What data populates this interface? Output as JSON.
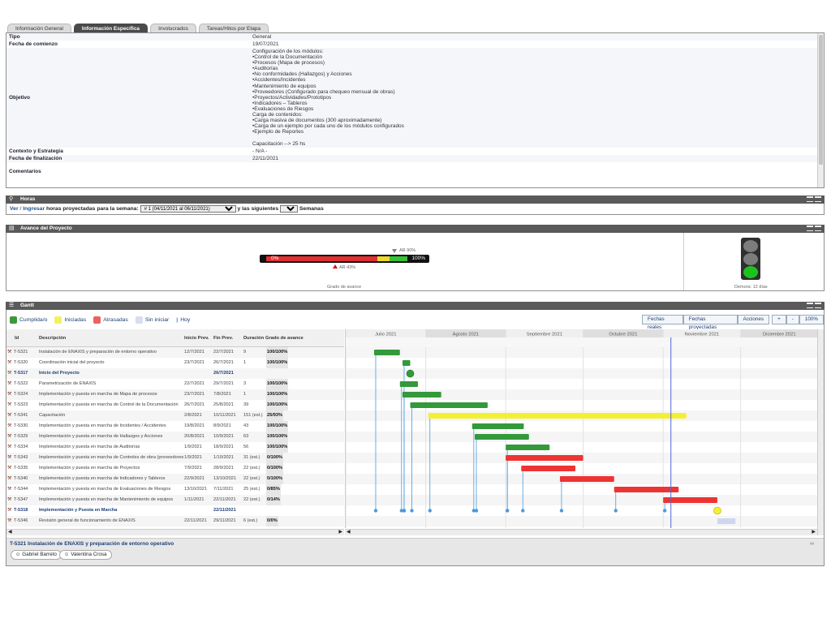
{
  "tabs": [
    {
      "label": "Información General",
      "active": false
    },
    {
      "label": "Información Específica",
      "active": true
    },
    {
      "label": "Involucrados",
      "active": false
    },
    {
      "label": "Tareas/Hitos por Etapa",
      "active": false
    }
  ],
  "info": {
    "tipo_label": "Tipo",
    "tipo_value": "General",
    "fecha_comienzo_label": "Fecha de comienzo",
    "fecha_comienzo_value": "19/07/2021",
    "objetivo_label": "Objetivo",
    "objetivo_lines": [
      "Configuración de los módulos:",
      "•Control de la Documentación",
      "•Procesos (Mapa de procesos)",
      "•Auditorías",
      "•No conformidades (Hallazgos) y Acciones",
      "•Accidentes/Incidentes",
      "•Mantenimiento de equipos",
      "•Proveedores (Configurado para chequeo mensual de obras)",
      "•Proyectos/Actividades/Prototipos",
      "•Indicadores – Tableros",
      "•Evaluaciones de Riesgos",
      "Carga de contenidos:",
      "•Carga masiva de documentos (300 aproximadamente)",
      "•Carga de un ejemplo por cada uno de los módulos configurados",
      "•Ejemplo de Reportes",
      "",
      "Capacitación --> 25 hs"
    ],
    "contexto_label": "Contexto y Estrategia",
    "contexto_value": "- N/A -",
    "fecha_fin_label": "Fecha de finalización",
    "fecha_fin_value": "22/11/2021",
    "comentarios_label": "Comentarios"
  },
  "horas": {
    "title": "Horas",
    "ver": "Ver",
    "sep": "/",
    "ingresar": "Ingresar",
    "text1": "horas proyectadas para la semana:",
    "week_option": "# 1 (04/11/2021 al 06/11/2021)",
    "text2": "y las siguientes",
    "weeks_count": "3",
    "text3": "Semanas"
  },
  "avance": {
    "title": "Avance del Proyecto",
    "pct_left": "0%",
    "pct_right": "100%",
    "real_label": "AR 43%",
    "proj_label": "AR 90%",
    "real_value": 43,
    "proj_value": 90,
    "grado_label": "Grado de avance",
    "demora_label": "Demora: 12 días",
    "semaforo_state": "green"
  },
  "gantt": {
    "title": "Gantt",
    "legend": [
      {
        "label": "Cumplida/o",
        "color": "#3a9a3a"
      },
      {
        "label": "Iniciadas",
        "color": "#f5f060"
      },
      {
        "label": "Atrasadas",
        "color": "#f06060"
      },
      {
        "label": "Sin iniciar",
        "color": "#d8ddf0"
      }
    ],
    "hoy_label": "Hoy",
    "buttons": {
      "fechas_reales": "Fechas reales",
      "fechas_proyectadas": "Fechas proyectadas",
      "acciones": "Acciones",
      "plus": "+",
      "minus": "-",
      "zoom": "100%"
    },
    "columns": {
      "id": "Id",
      "descripcion": "Descripción",
      "inicio": "Inicio Prev.",
      "fin": "Fin Prev.",
      "duracion": "Duración",
      "grado": "Grado de avance"
    },
    "months": [
      "Julio 2021",
      "Agosto 2021",
      "Septiembre 2021",
      "Octubre 2021",
      "Noviembre 2021",
      "Diciembre 2021"
    ],
    "rows": [
      {
        "id": "T-5321",
        "desc": "Instalación de ENAXIS y preparación de entorno operativo",
        "start": "12/7/2021",
        "end": "22/7/2021",
        "dur": "9",
        "pct": "100/100%",
        "ms": false
      },
      {
        "id": "T-5320",
        "desc": "Coordinación inicial del proyecto",
        "start": "23/7/2021",
        "end": "26/7/2021",
        "dur": "1",
        "pct": "100/100%",
        "ms": false
      },
      {
        "id": "T-5317",
        "desc": "Inicio del Proyecto",
        "start": "",
        "end": "26/7/2021",
        "dur": "",
        "pct": "",
        "ms": true
      },
      {
        "id": "T-5322",
        "desc": "Parametrización de ENAXIS",
        "start": "22/7/2021",
        "end": "29/7/2021",
        "dur": "3",
        "pct": "100/100%",
        "ms": false
      },
      {
        "id": "T-5324",
        "desc": "Implementación y puesta en marcha de Mapa de procesos",
        "start": "23/7/2021",
        "end": "7/8/2021",
        "dur": "1",
        "pct": "100/100%",
        "ms": false
      },
      {
        "id": "T-5323",
        "desc": "Implementación y puesta en marcha de Control de la Documentación",
        "start": "26/7/2021",
        "end": "25/8/2021",
        "dur": "39",
        "pct": "100/100%",
        "ms": false
      },
      {
        "id": "T-5341",
        "desc": "Capacitación",
        "start": "2/8/2021",
        "end": "10/11/2021",
        "dur": "151 (est.)",
        "pct": "25/93%",
        "ms": false
      },
      {
        "id": "T-5330",
        "desc": "Implementación y puesta en marcha de Incidentes / Accidentes",
        "start": "19/8/2021",
        "end": "8/9/2021",
        "dur": "43",
        "pct": "100/100%",
        "ms": false
      },
      {
        "id": "T-5329",
        "desc": "Implementación y puesta en marcha de Hallazgos y Acciones",
        "start": "20/8/2021",
        "end": "10/9/2021",
        "dur": "63",
        "pct": "100/100%",
        "ms": false
      },
      {
        "id": "T-5334",
        "desc": "Implementación y puesta en marcha de Auditorías",
        "start": "1/9/2021",
        "end": "18/9/2021",
        "dur": "56",
        "pct": "100/100%",
        "ms": false
      },
      {
        "id": "T-5343",
        "desc": "Implementación y puesta en marcha de Controles de obra (proveedores)",
        "start": "1/9/2021",
        "end": "1/10/2021",
        "dur": "31 (est.)",
        "pct": "0/100%",
        "ms": false
      },
      {
        "id": "T-5335",
        "desc": "Implementación y puesta en marcha de Proyectos",
        "start": "7/9/2021",
        "end": "28/9/2021",
        "dur": "22 (est.)",
        "pct": "0/100%",
        "ms": false
      },
      {
        "id": "T-5340",
        "desc": "Implementación y puesta en marcha de Indicadores y Tableros",
        "start": "22/9/2021",
        "end": "13/10/2021",
        "dur": "22 (est.)",
        "pct": "0/100%",
        "ms": false
      },
      {
        "id": "T-5344",
        "desc": "Implementación y puesta en marcha de Evaluaciones de Riesgos",
        "start": "13/10/2021",
        "end": "7/11/2021",
        "dur": "25 (est.)",
        "pct": "0/85%",
        "ms": false
      },
      {
        "id": "T-5347",
        "desc": "Implementación y puesta en marcha de Mantenimiento de equipos",
        "start": "1/11/2021",
        "end": "22/11/2021",
        "dur": "22 (est.)",
        "pct": "0/14%",
        "ms": false
      },
      {
        "id": "T-5318",
        "desc": "Implementación y Puesta en Marcha",
        "start": "",
        "end": "22/11/2021",
        "dur": "",
        "pct": "",
        "ms": true
      },
      {
        "id": "T-5346",
        "desc": "Revisión general de funcionamiento de ENAXIS",
        "start": "22/11/2021",
        "end": "29/11/2021",
        "dur": "6 (est.)",
        "pct": "0/0%",
        "ms": false
      }
    ],
    "chart_data": {
      "type": "gantt",
      "bars": [
        {
          "start": "2021-07-12",
          "end": "2021-07-22",
          "status": "done"
        },
        {
          "start": "2021-07-23",
          "end": "2021-07-26",
          "status": "done"
        },
        {
          "milestone": "2021-07-26",
          "status": "done"
        },
        {
          "start": "2021-07-22",
          "end": "2021-07-29",
          "status": "done"
        },
        {
          "start": "2021-07-23",
          "end": "2021-08-07",
          "status": "done"
        },
        {
          "start": "2021-07-26",
          "end": "2021-08-25",
          "status": "done"
        },
        {
          "start": "2021-08-02",
          "end": "2021-11-10",
          "status": "started"
        },
        {
          "start": "2021-08-19",
          "end": "2021-09-08",
          "status": "done"
        },
        {
          "start": "2021-08-20",
          "end": "2021-09-10",
          "status": "done"
        },
        {
          "start": "2021-09-01",
          "end": "2021-09-18",
          "status": "done"
        },
        {
          "start": "2021-09-01",
          "end": "2021-10-01",
          "status": "late"
        },
        {
          "start": "2021-09-07",
          "end": "2021-09-28",
          "status": "late"
        },
        {
          "start": "2021-09-22",
          "end": "2021-10-13",
          "status": "late"
        },
        {
          "start": "2021-10-13",
          "end": "2021-11-07",
          "status": "late"
        },
        {
          "start": "2021-11-01",
          "end": "2021-11-22",
          "status": "late"
        },
        {
          "milestone": "2021-11-22",
          "status": "started"
        },
        {
          "start": "2021-11-22",
          "end": "2021-11-29",
          "status": "not_started"
        }
      ],
      "today": "2021-11-04",
      "range": [
        "2021-07-01",
        "2021-12-31"
      ]
    },
    "footer_title": "T-5321 Instalación de ENAXIS y preparación de entorno operativo",
    "people": [
      "Gabriel Barreto",
      "Valentina Crosa"
    ]
  },
  "colors": {
    "done": "#33993a",
    "started": "#f3f032",
    "late": "#ee3333",
    "not_started": "#cfd6ef",
    "today": "#5565d6",
    "link": "#4a9ae0"
  }
}
